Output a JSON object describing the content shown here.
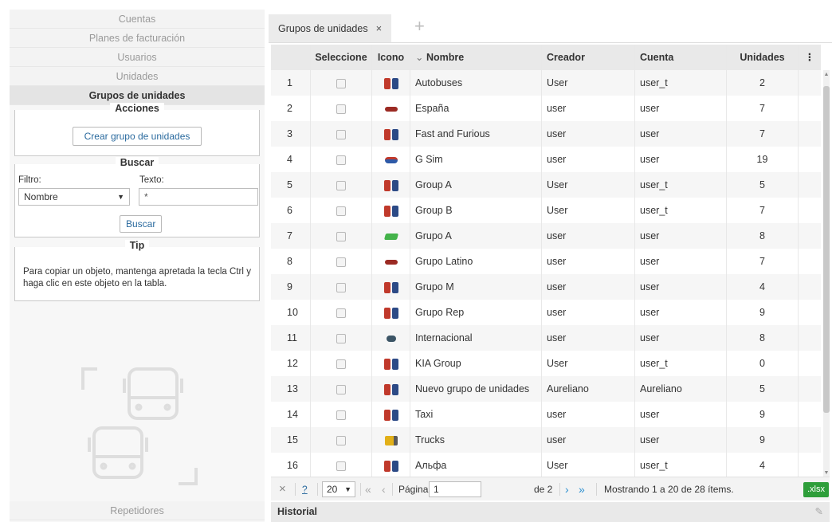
{
  "sidebar": {
    "nav": [
      {
        "label": "Cuentas"
      },
      {
        "label": "Planes de facturación"
      },
      {
        "label": "Usuarios"
      },
      {
        "label": "Unidades"
      },
      {
        "label": "Grupos de unidades",
        "active": true
      }
    ],
    "acciones": {
      "title": "Acciones",
      "create_button": "Crear grupo de unidades"
    },
    "buscar": {
      "title": "Buscar",
      "filter_label": "Filtro:",
      "filter_value": "Nombre",
      "text_label": "Texto:",
      "text_value": "*",
      "search_button": "Buscar"
    },
    "tip": {
      "title": "Tip",
      "text": "Para copiar un objeto, mantenga apretada la tecla Ctrl y haga clic en este objeto en la tabla."
    },
    "bottom_nav": {
      "label": "Repetidores"
    }
  },
  "tabs": [
    {
      "label": "Grupos de unidades",
      "close": "×"
    }
  ],
  "add_tab": "+",
  "table": {
    "columns": {
      "select": "Seleccione",
      "icon": "Icono",
      "name": "Nombre",
      "name_sort": "⌄",
      "creator": "Creador",
      "account": "Cuenta",
      "units": "Unidades",
      "menu": "⋮"
    },
    "rows": [
      {
        "num": "1",
        "icon": "bus-icon",
        "name": "Autobuses",
        "creator": "User",
        "account": "user_t",
        "units": "2"
      },
      {
        "num": "2",
        "icon": "car-red-icon",
        "name": "España",
        "creator": "user",
        "account": "user",
        "units": "7"
      },
      {
        "num": "3",
        "icon": "bus-icon",
        "name": "Fast and Furious",
        "creator": "user",
        "account": "user",
        "units": "7"
      },
      {
        "num": "4",
        "icon": "car-mix-icon",
        "name": "G Sim",
        "creator": "user",
        "account": "user",
        "units": "19"
      },
      {
        "num": "5",
        "icon": "bus-icon",
        "name": "Group A",
        "creator": "User",
        "account": "user_t",
        "units": "5"
      },
      {
        "num": "6",
        "icon": "bus-icon",
        "name": "Group B",
        "creator": "User",
        "account": "user_t",
        "units": "7"
      },
      {
        "num": "7",
        "icon": "car-green-icon",
        "name": "Grupo A",
        "creator": "user",
        "account": "user",
        "units": "8"
      },
      {
        "num": "8",
        "icon": "car-red-icon",
        "name": "Grupo Latino",
        "creator": "user",
        "account": "user",
        "units": "7"
      },
      {
        "num": "9",
        "icon": "bus-icon",
        "name": "Grupo M",
        "creator": "user",
        "account": "user",
        "units": "4"
      },
      {
        "num": "10",
        "icon": "bus-icon",
        "name": "Grupo Rep",
        "creator": "user",
        "account": "user",
        "units": "9"
      },
      {
        "num": "11",
        "icon": "car-dark-icon",
        "name": "Internacional",
        "creator": "user",
        "account": "user",
        "units": "8"
      },
      {
        "num": "12",
        "icon": "bus-icon",
        "name": "KIA Group",
        "creator": "User",
        "account": "user_t",
        "units": "0"
      },
      {
        "num": "13",
        "icon": "bus-icon",
        "name": "Nuevo grupo de unidades",
        "creator": "Aureliano",
        "account": "Aureliano",
        "units": "5"
      },
      {
        "num": "14",
        "icon": "bus-icon",
        "name": "Taxi",
        "creator": "user",
        "account": "user",
        "units": "9"
      },
      {
        "num": "15",
        "icon": "truck-icon",
        "name": "Trucks",
        "creator": "user",
        "account": "user",
        "units": "9"
      },
      {
        "num": "16",
        "icon": "bus-icon",
        "name": "Альфа",
        "creator": "User",
        "account": "user_t",
        "units": "4"
      }
    ]
  },
  "pager": {
    "clear": "×",
    "help": "?",
    "page_size": "20",
    "first": "«",
    "prev": "‹",
    "page_label": "Página",
    "page_value": "1",
    "of_label": "de 2",
    "next": "›",
    "last": "»",
    "summary": "Mostrando 1 a 20 de 28 ítems.",
    "export": ".xlsx"
  },
  "history": {
    "label": "Historial"
  },
  "colors": {
    "export_button": "#2e9e3a",
    "link": "#2a6a9e",
    "header_bg": "#e9e9e9"
  }
}
